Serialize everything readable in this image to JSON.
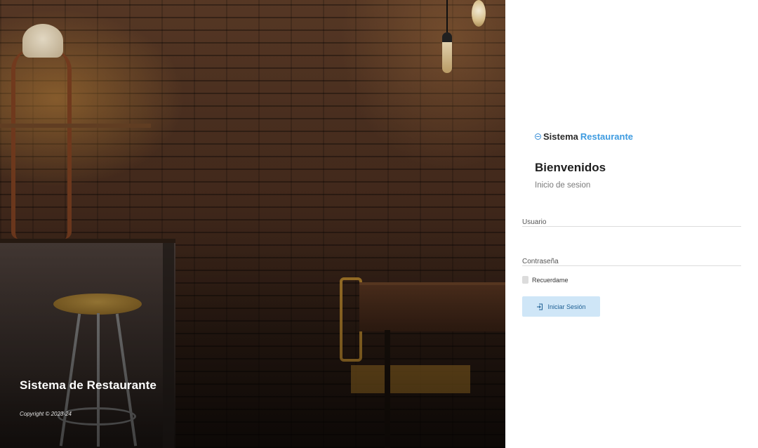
{
  "hero": {
    "title": "Sistema de Restaurante",
    "copyright": "Copyright © 2023-24"
  },
  "login": {
    "brand": {
      "part1": "Sistema",
      "part2": "Restaurante",
      "icon": "globe-icon"
    },
    "welcome": "Bienvenidos",
    "subtitle": "Inicio de sesion",
    "username": {
      "placeholder": "Usuario",
      "value": ""
    },
    "password": {
      "placeholder": "Contraseña",
      "value": ""
    },
    "remember_label": "Recuerdame",
    "remember_checked": false,
    "submit_label": "Iniciar Sesión",
    "submit_icon": "login-icon"
  },
  "colors": {
    "brand_accent": "#3e9be0",
    "button_bg": "#cfe6f7",
    "button_text": "#1d5f93"
  }
}
